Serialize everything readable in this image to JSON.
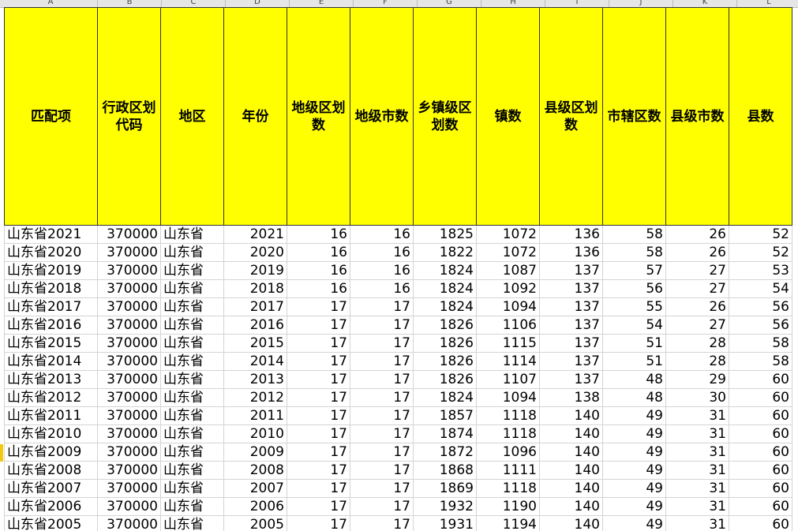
{
  "columns": [
    "A",
    "B",
    "C",
    "D",
    "E",
    "F",
    "G",
    "H",
    "I",
    "J",
    "K",
    "L"
  ],
  "headers": [
    "匹配项",
    "行政区划代码",
    "地区",
    "年份",
    "地级区划数",
    "地级市数",
    "乡镇级区划数",
    "镇数",
    "县级区划数",
    "市辖区数",
    "县级市数",
    "县数"
  ],
  "rows": [
    [
      "山东省2021",
      "370000",
      "山东省",
      "2021",
      "16",
      "16",
      "1825",
      "1072",
      "136",
      "58",
      "26",
      "52"
    ],
    [
      "山东省2020",
      "370000",
      "山东省",
      "2020",
      "16",
      "16",
      "1822",
      "1072",
      "136",
      "58",
      "26",
      "52"
    ],
    [
      "山东省2019",
      "370000",
      "山东省",
      "2019",
      "16",
      "16",
      "1824",
      "1087",
      "137",
      "57",
      "27",
      "53"
    ],
    [
      "山东省2018",
      "370000",
      "山东省",
      "2018",
      "16",
      "16",
      "1824",
      "1092",
      "137",
      "56",
      "27",
      "54"
    ],
    [
      "山东省2017",
      "370000",
      "山东省",
      "2017",
      "17",
      "17",
      "1824",
      "1094",
      "137",
      "55",
      "26",
      "56"
    ],
    [
      "山东省2016",
      "370000",
      "山东省",
      "2016",
      "17",
      "17",
      "1826",
      "1106",
      "137",
      "54",
      "27",
      "56"
    ],
    [
      "山东省2015",
      "370000",
      "山东省",
      "2015",
      "17",
      "17",
      "1826",
      "1115",
      "137",
      "51",
      "28",
      "58"
    ],
    [
      "山东省2014",
      "370000",
      "山东省",
      "2014",
      "17",
      "17",
      "1826",
      "1114",
      "137",
      "51",
      "28",
      "58"
    ],
    [
      "山东省2013",
      "370000",
      "山东省",
      "2013",
      "17",
      "17",
      "1826",
      "1107",
      "137",
      "48",
      "29",
      "60"
    ],
    [
      "山东省2012",
      "370000",
      "山东省",
      "2012",
      "17",
      "17",
      "1824",
      "1094",
      "138",
      "48",
      "30",
      "60"
    ],
    [
      "山东省2011",
      "370000",
      "山东省",
      "2011",
      "17",
      "17",
      "1857",
      "1118",
      "140",
      "49",
      "31",
      "60"
    ],
    [
      "山东省2010",
      "370000",
      "山东省",
      "2010",
      "17",
      "17",
      "1874",
      "1118",
      "140",
      "49",
      "31",
      "60"
    ],
    [
      "山东省2009",
      "370000",
      "山东省",
      "2009",
      "17",
      "17",
      "1872",
      "1096",
      "140",
      "49",
      "31",
      "60"
    ],
    [
      "山东省2008",
      "370000",
      "山东省",
      "2008",
      "17",
      "17",
      "1868",
      "1111",
      "140",
      "49",
      "31",
      "60"
    ],
    [
      "山东省2007",
      "370000",
      "山东省",
      "2007",
      "17",
      "17",
      "1869",
      "1118",
      "140",
      "49",
      "31",
      "60"
    ],
    [
      "山东省2006",
      "370000",
      "山东省",
      "2006",
      "17",
      "17",
      "1932",
      "1190",
      "140",
      "49",
      "31",
      "60"
    ],
    [
      "山东省2005",
      "370000",
      "山东省",
      "2005",
      "17",
      "17",
      "1931",
      "1194",
      "140",
      "49",
      "31",
      "60"
    ]
  ],
  "colors": {
    "header_fill": "#ffff00",
    "grid": "#d4d4d4",
    "row_marker": "#f2c811"
  }
}
